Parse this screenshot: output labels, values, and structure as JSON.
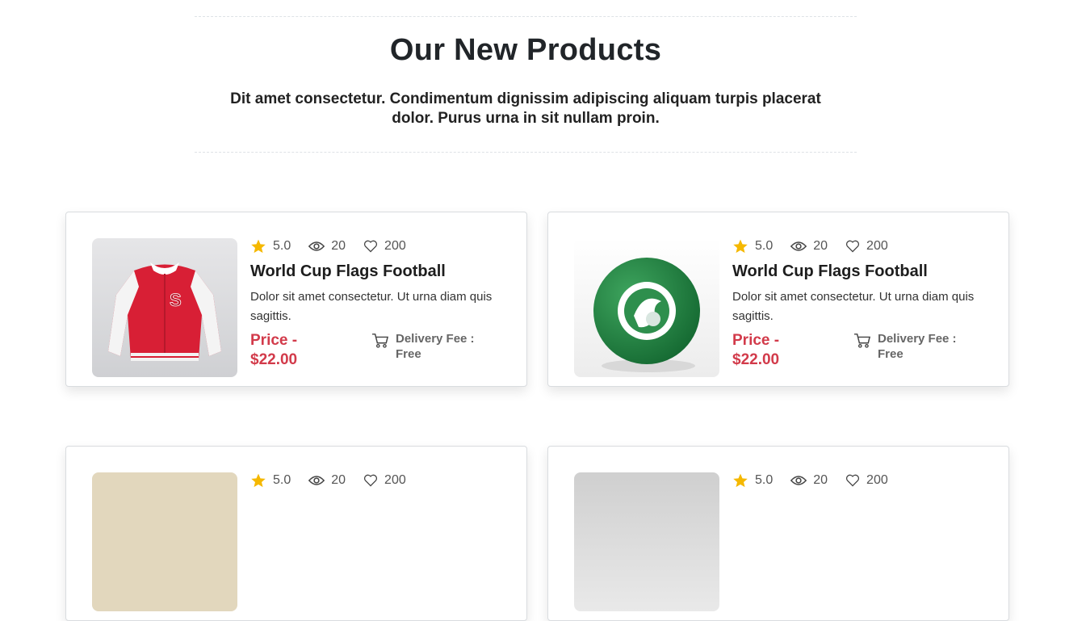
{
  "section": {
    "title": "Our New Products",
    "subtitle": "Dit amet consectetur. Condimentum dignissim adipiscing aliquam turpis placerat dolor. Purus urna in sit nullam proin."
  },
  "products": [
    {
      "rating": "5.0",
      "views": "20",
      "likes": "200",
      "title": "World Cup Flags Football",
      "description": "Dolor sit amet consectetur. Ut urna diam quis sagittis.",
      "price": "Price - $22.00",
      "delivery": "Delivery Fee : Free",
      "image_icon": "red-varsity-jacket"
    },
    {
      "rating": "5.0",
      "views": "20",
      "likes": "200",
      "title": "World Cup Flags Football",
      "description": "Dolor sit amet consectetur. Ut urna diam quis sagittis.",
      "price": "Price - $22.00",
      "delivery": "Delivery Fee : Free",
      "image_icon": "green-football"
    },
    {
      "rating": "5.0",
      "views": "20",
      "likes": "200",
      "image_icon": "beige-product"
    },
    {
      "rating": "5.0",
      "views": "20",
      "likes": "200",
      "image_icon": "grey-product"
    }
  ],
  "colors": {
    "price": "#d23a4a",
    "star": "#f5b800"
  }
}
